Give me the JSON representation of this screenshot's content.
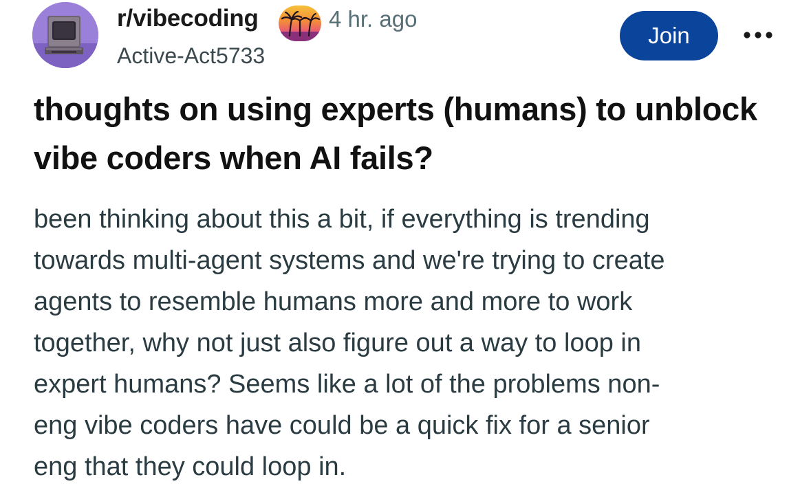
{
  "post": {
    "subreddit": "r/vibecoding",
    "subreddit_icon": "retro-computer-icon",
    "flair_icon": "palm-tree-sunset-icon",
    "time_ago": "4 hr. ago",
    "author": "Active-Act5733",
    "join_label": "Join",
    "more_icon": "more-options-icon",
    "title": "thoughts on using experts (humans) to unblock vibe coders when AI fails?",
    "body_lines": [
      "been thinking about this a bit, if everything is trending",
      "towards multi-agent systems and we're trying to create",
      "agents to resemble humans more and more to work",
      "together, why not just also figure out a way to loop in",
      "expert humans? Seems like a lot of the problems non-",
      "eng vibe coders have could be a quick fix for a senior",
      "eng that they could loop in."
    ]
  },
  "colors": {
    "join_button": "#0a449b",
    "avatar_bg": "#9a7fd8",
    "title_text": "#111111",
    "body_text": "#2a3c42",
    "meta_text": "#576f76"
  }
}
